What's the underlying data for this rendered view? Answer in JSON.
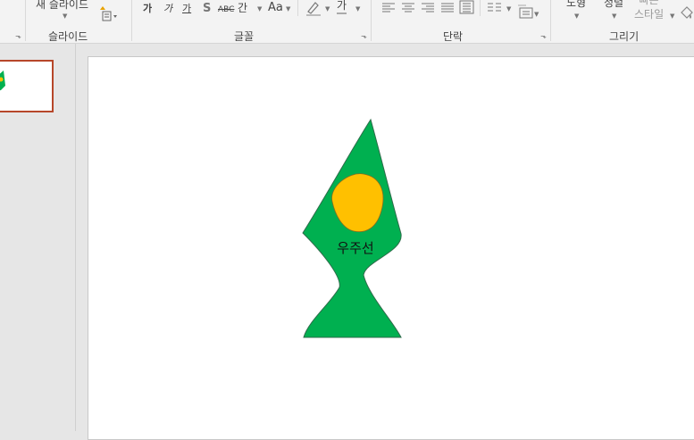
{
  "ribbon": {
    "slides_group": {
      "new_slide_label": "새 슬라이드",
      "group_label": "슬라이드"
    },
    "font_group": {
      "group_label": "글꼴",
      "bold_glyph": "가",
      "italic_glyph": "가",
      "underline_glyph": "가",
      "shadow_glyph": "S",
      "strike_glyph": "ABC",
      "spacing_glyph": "간",
      "case_glyph": "Aa",
      "color_glyph": "가"
    },
    "paragraph_group": {
      "group_label": "단락"
    },
    "drawing_group": {
      "group_label": "그리기",
      "arrange_label": "정렬",
      "quick_style_line1": "빠른",
      "quick_style_line2": "스타일",
      "shapes_label": "도형"
    }
  },
  "slide": {
    "shape_text": "우주선",
    "rocket_fill": "#00b050",
    "window_fill": "#ffc000"
  }
}
